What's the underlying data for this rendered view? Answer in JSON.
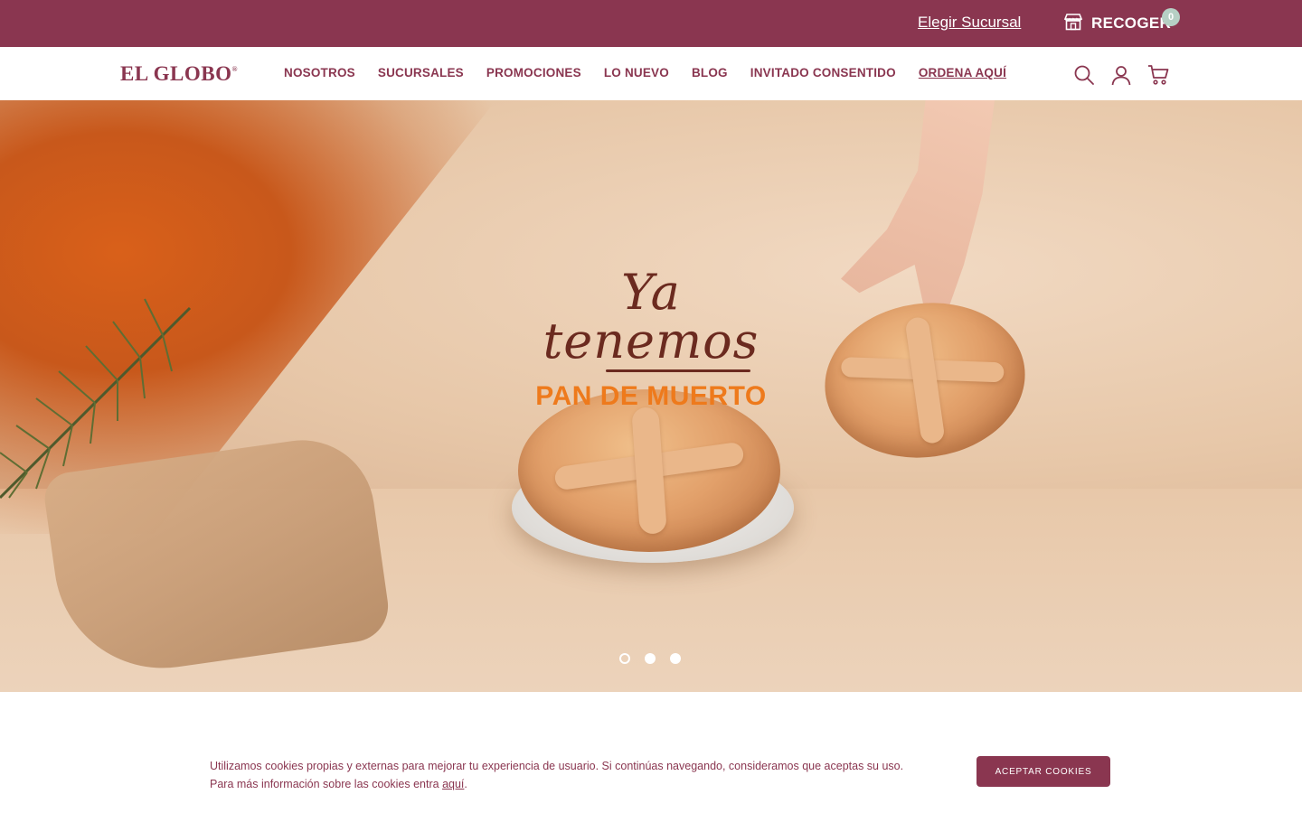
{
  "topbar": {
    "branch_link": "Elegir Sucursal",
    "pickup_label": "RECOGER",
    "pickup_icon": "store-icon",
    "background_color": "#8a3650"
  },
  "navbar": {
    "logo": "EL GLOBO",
    "logo_mark": "®",
    "links": [
      {
        "label": "NOSOTROS"
      },
      {
        "label": "SUCURSALES"
      },
      {
        "label": "PROMOCIONES"
      },
      {
        "label": "LO NUEVO"
      },
      {
        "label": "BLOG"
      },
      {
        "label": "INVITADO CONSENTIDO"
      },
      {
        "label": "ORDENA AQUÍ"
      }
    ],
    "icons": [
      "search-icon",
      "user-icon",
      "cart-icon"
    ],
    "cart_count": "0"
  },
  "hero": {
    "script_title": "Ya tenemos",
    "subtitle": "PAN DE MUERTO",
    "slides_total": 3,
    "active_slide": 1
  },
  "cookie_banner": {
    "text_line1": "Utilizamos cookies propias y externas para mejorar tu experiencia de usuario. Si continúas navegando, consideramos que aceptas su uso.",
    "text_line2_prefix": "Para más información sobre las cookies entra ",
    "link_text": "aquí",
    "text_suffix": ".",
    "accept_button": "ACEPTAR COOKIES"
  },
  "colors": {
    "brand": "#8a3650",
    "accent_orange": "#ee7a1c",
    "badge": "#b6cfc4"
  }
}
